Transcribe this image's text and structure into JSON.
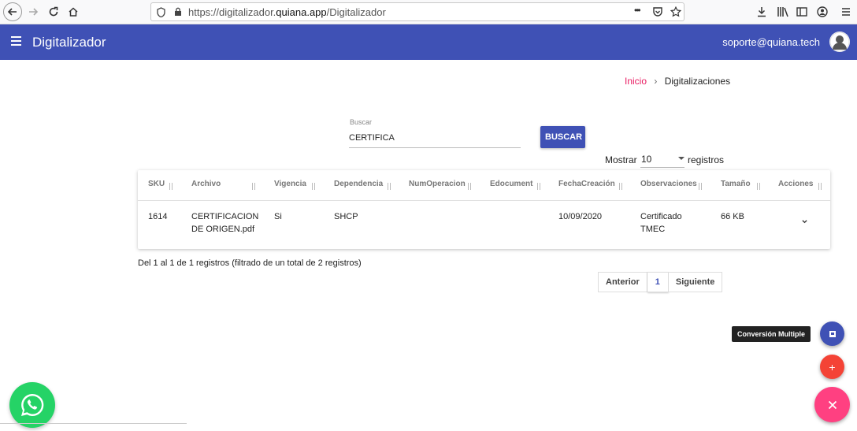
{
  "browser": {
    "url_prefix": "https://digitalizador.",
    "url_domain": "quiana.app",
    "url_path": "/Digitalizador",
    "more_icon": "•••"
  },
  "appbar": {
    "title": "Digitalizador",
    "user_email": "soporte@quiana.tech",
    "color": "#3f51b5"
  },
  "breadcrumb": {
    "home": "Inicio",
    "separator": "›",
    "current": "Digitalizaciones"
  },
  "search": {
    "label": "Buscar",
    "value": "CERTIFICA",
    "button_label": "BUSCAR"
  },
  "page_size": {
    "prefix": "Mostrar",
    "value": "10",
    "suffix": "registros"
  },
  "table": {
    "columns": [
      "SKU",
      "Archivo",
      "Vigencia",
      "Dependencia",
      "NumOperacion",
      "Edocument",
      "FechaCreación",
      "Observaciones",
      "Tamaño",
      "Acciones"
    ],
    "rows": [
      {
        "sku": "1614",
        "archivo_line1": "CERTIFICACION",
        "archivo_line2": "DE ORIGEN.pdf",
        "vigencia": "Si",
        "dependencia": "SHCP",
        "numoperacion": "",
        "edocument": "",
        "fecha": "10/09/2020",
        "observaciones_line1": "Certificado",
        "observaciones_line2": "TMEC",
        "tamano": "66 KB"
      }
    ]
  },
  "summary": "Del 1 al 1 de 1 registros (filtrado de un total de 2 registros)",
  "pagination": {
    "previous": "Anterior",
    "current": "1",
    "next": "Siguiente"
  },
  "fabs": {
    "tooltip": "Conversión Multiple",
    "add_symbol": "+",
    "conv_color": "#3f51b5",
    "add_color": "#f44336",
    "main_color": "#ff4081"
  }
}
